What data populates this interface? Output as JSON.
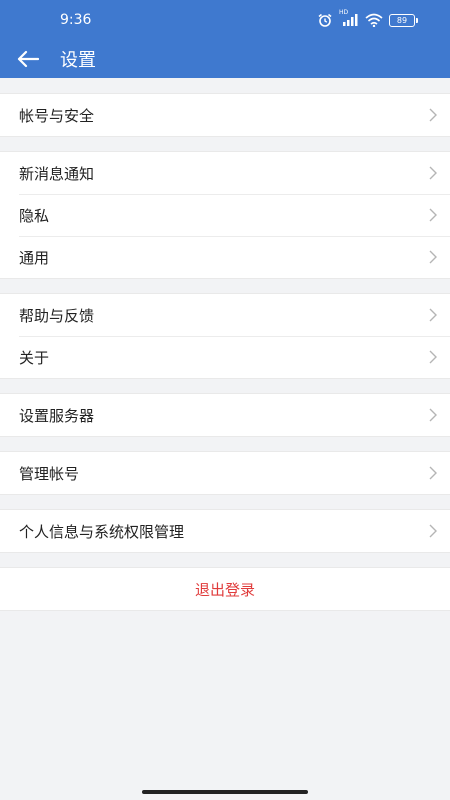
{
  "status": {
    "time": "9:36",
    "battery": "89",
    "hd": "HD"
  },
  "header": {
    "title": "设置"
  },
  "groups": [
    {
      "items": [
        {
          "label": "帐号与安全"
        }
      ]
    },
    {
      "items": [
        {
          "label": "新消息通知"
        },
        {
          "label": "隐私"
        },
        {
          "label": "通用"
        }
      ]
    },
    {
      "items": [
        {
          "label": "帮助与反馈"
        },
        {
          "label": "关于"
        }
      ]
    },
    {
      "items": [
        {
          "label": "设置服务器"
        }
      ]
    },
    {
      "items": [
        {
          "label": "管理帐号"
        }
      ]
    },
    {
      "items": [
        {
          "label": "个人信息与系统权限管理"
        }
      ]
    }
  ],
  "logout": {
    "label": "退出登录"
  },
  "colors": {
    "primary": "#3f79cf",
    "danger": "#e03c3c",
    "background": "#f2f3f5"
  }
}
